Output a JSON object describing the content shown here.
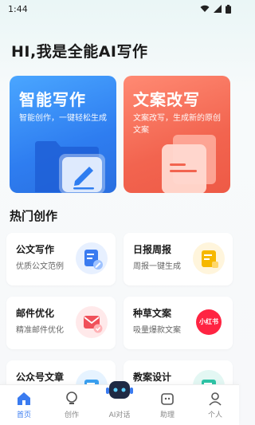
{
  "status": {
    "time": "1:44"
  },
  "page_title": "HI,我是全能AI写作",
  "hero_cards": [
    {
      "title": "智能写作",
      "desc": "智能创作，一键轻松生成"
    },
    {
      "title": "文案改写",
      "desc": "文案改写，生成新的原创文案"
    }
  ],
  "section_title": "热门创作",
  "cards": [
    {
      "title": "公文写作",
      "desc": "优质公文范例",
      "icon": "document-pen-icon"
    },
    {
      "title": "日报周报",
      "desc": "周报一键生成",
      "icon": "report-icon"
    },
    {
      "title": "邮件优化",
      "desc": "精准邮件优化",
      "icon": "mail-check-icon"
    },
    {
      "title": "种草文案",
      "desc": "吸量爆款文案",
      "icon": "xiaohongshu-icon",
      "icon_text": "小红书"
    },
    {
      "title": "公众号文章",
      "desc": "",
      "icon": "article-icon"
    },
    {
      "title": "教案设计",
      "desc": "",
      "icon": "lesson-plan-icon"
    }
  ],
  "tabs": [
    {
      "label": "首页",
      "icon": "home-icon",
      "active": true
    },
    {
      "label": "创作",
      "icon": "bulb-icon",
      "active": false
    },
    {
      "label": "AI对话",
      "icon": "robot-icon",
      "active": false
    },
    {
      "label": "助理",
      "icon": "assistant-icon",
      "active": false
    },
    {
      "label": "个人",
      "icon": "user-icon",
      "active": false
    }
  ],
  "colors": {
    "accent": "#3a7bf0",
    "hero_blue": "#3a8cf6",
    "hero_red": "#f2644f"
  }
}
